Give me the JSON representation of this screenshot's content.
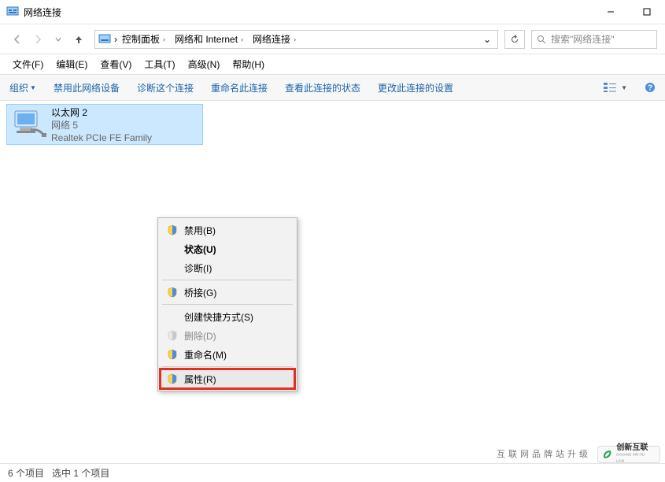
{
  "window": {
    "title": "网络连接"
  },
  "breadcrumb": {
    "crumb1": "控制面板",
    "crumb2": "网络和 Internet",
    "crumb3": "网络连接"
  },
  "search": {
    "placeholder": "搜索\"网络连接\""
  },
  "menubar": {
    "file": "文件(F)",
    "edit": "编辑(E)",
    "view": "查看(V)",
    "tools": "工具(T)",
    "advanced": "高级(N)",
    "help": "帮助(H)"
  },
  "cmdbar": {
    "organize": "组织",
    "disable": "禁用此网络设备",
    "diagnose": "诊断这个连接",
    "rename": "重命名此连接",
    "status": "查看此连接的状态",
    "change": "更改此连接的设置"
  },
  "adapter": {
    "name": "以太网 2",
    "status": "网络 5",
    "device": "Realtek PCIe FE Family"
  },
  "context_menu": {
    "disable": "禁用(B)",
    "status": "状态(U)",
    "diagnose": "诊断(I)",
    "bridge": "桥接(G)",
    "shortcut": "创建快捷方式(S)",
    "delete": "删除(D)",
    "rename": "重命名(M)",
    "properties": "属性(R)"
  },
  "statusbar": {
    "count_a": "6 个项目",
    "count_b": "选中 1 个项目"
  },
  "watermark": {
    "brand_text": "创新互联",
    "brand_sub": "CHUANG XIN HU LIAN",
    "text": "互联网品牌站升级"
  }
}
